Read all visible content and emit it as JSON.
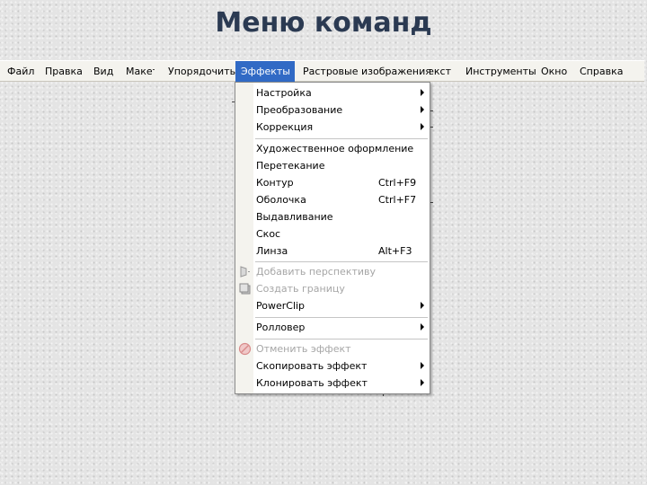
{
  "title": "Меню команд",
  "menubar": {
    "items": [
      {
        "label": "Файл"
      },
      {
        "label": "Правка"
      },
      {
        "label": "Вид"
      },
      {
        "label": "Макет"
      },
      {
        "label": "Упорядочить"
      },
      {
        "label": "Эффекты"
      },
      {
        "label": "Растровые изображения"
      },
      {
        "label": "Текст"
      },
      {
        "label": "Инструменты"
      },
      {
        "label": "Окно"
      },
      {
        "label": "Справка"
      }
    ],
    "active_index": 5
  },
  "effects_menu": {
    "items": [
      {
        "label": "Настройка",
        "submenu": true
      },
      {
        "label": "Преобразование",
        "submenu": true
      },
      {
        "label": "Коррекция",
        "submenu": true
      },
      {
        "label": "Художественное оформление"
      },
      {
        "label": "Перетекание"
      },
      {
        "label": "Контур",
        "shortcut": "Ctrl+F9"
      },
      {
        "label": "Оболочка",
        "shortcut": "Ctrl+F7"
      },
      {
        "label": "Выдавливание"
      },
      {
        "label": "Скос"
      },
      {
        "label": "Линза",
        "shortcut": "Alt+F3"
      },
      {
        "label": "Добавить перспективу",
        "disabled": true,
        "icon": "perspective-icon"
      },
      {
        "label": "Создать границу",
        "disabled": true,
        "icon": "boundary-icon"
      },
      {
        "label": "PowerClip",
        "submenu": true
      },
      {
        "label": "Ролловер",
        "submenu": true
      },
      {
        "label": "Отменить эффект",
        "disabled": true,
        "icon": "clear-effect-icon"
      },
      {
        "label": "Скопировать эффект",
        "submenu": true
      },
      {
        "label": "Клонировать эффект",
        "submenu": true
      }
    ]
  },
  "colors": {
    "menu_highlight": "#316ac5",
    "title_text": "#2b3a52",
    "disabled_text": "#a6a6a6"
  }
}
